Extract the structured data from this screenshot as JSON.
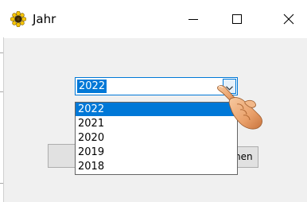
{
  "window": {
    "title": "Jahr",
    "controls": {
      "minimize_icon": "minimize-icon",
      "maximize_icon": "maximize-icon",
      "close_icon": "close-icon"
    }
  },
  "year_combo": {
    "selected": "2022",
    "options": [
      "2022",
      "2021",
      "2020",
      "2019",
      "2018"
    ],
    "highlighted_index": 0
  },
  "buttons": {
    "right_partial_label": "hen"
  },
  "colors": {
    "accent": "#0078d7",
    "client_bg": "#f0f0f0",
    "button_bg": "#e1e1e1"
  },
  "icons": {
    "app": "sunflower-icon",
    "cursor": "pointing-hand-icon",
    "dropdown": "chevron-down-icon"
  }
}
